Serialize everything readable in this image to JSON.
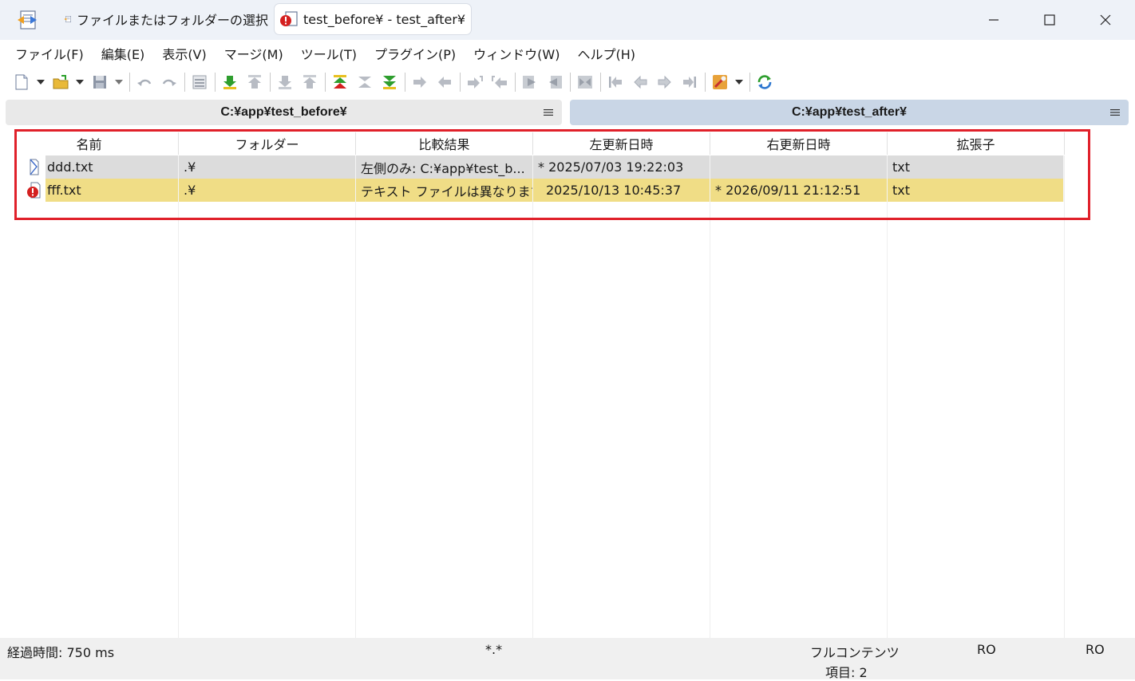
{
  "titlebar": {
    "tabs": [
      {
        "label": "ファイルまたはフォルダーの選択"
      },
      {
        "label": "test_before¥ - test_after¥"
      }
    ]
  },
  "menu": [
    {
      "label": "ファイル(F)"
    },
    {
      "label": "編集(E)"
    },
    {
      "label": "表示(V)"
    },
    {
      "label": "マージ(M)"
    },
    {
      "label": "ツール(T)"
    },
    {
      "label": "プラグイン(P)"
    },
    {
      "label": "ウィンドウ(W)"
    },
    {
      "label": "ヘルプ(H)"
    }
  ],
  "paths": {
    "left": "C:¥app¥test_before¥",
    "right": "C:¥app¥test_after¥"
  },
  "columns": [
    "名前",
    "フォルダー",
    "比較結果",
    "左更新日時",
    "右更新日時",
    "拡張子"
  ],
  "rows": [
    {
      "name": "ddd.txt",
      "folder": ".¥",
      "result": "左側のみ: C:¥app¥test_b...",
      "left_date": "* 2025/07/03 19:22:03",
      "right_date": "",
      "ext": "txt"
    },
    {
      "name": "fff.txt",
      "folder": ".¥",
      "result": "テキスト ファイルは異なります",
      "left_date": "2025/10/13 10:45:37",
      "right_date": "* 2026/09/11 21:12:51",
      "ext": "txt"
    }
  ],
  "status": {
    "elapsed": "経過時間: 750 ms",
    "filter": "*.*",
    "compare_method": "フルコンテンツ",
    "items": "項目: 2",
    "left_ro": "RO",
    "right_ro": "RO"
  },
  "colors": {
    "row_left_only": "#dcdcdc",
    "row_different": "#f0dd86",
    "highlight": "#e0202a",
    "path_right_active": "#c9d6e6"
  }
}
